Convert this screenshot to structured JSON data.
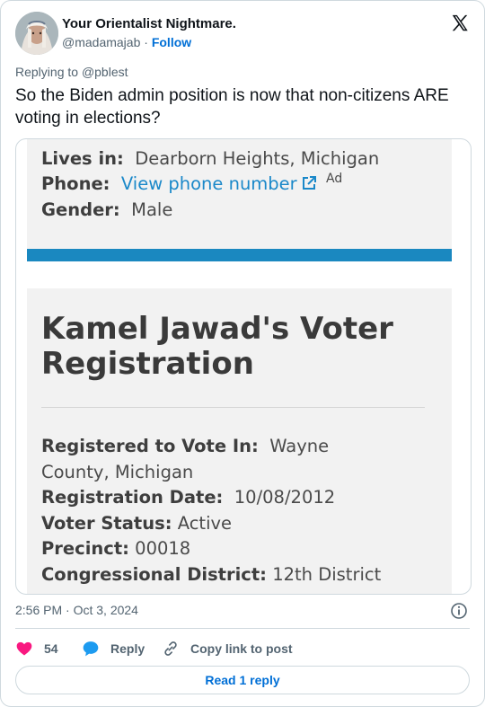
{
  "author": {
    "display_name": "Your Orientalist Nightmare.",
    "handle": "@madamajab",
    "separator": "·",
    "follow_label": "Follow"
  },
  "icons": {
    "brand": "x-logo-icon",
    "external_link": "external-link-icon",
    "info": "info-icon",
    "like": "heart-icon",
    "reply": "speech-bubble-icon",
    "copy": "link-icon"
  },
  "replying_to": {
    "prefix": "Replying to",
    "handle": "@pblest"
  },
  "tweet_text": "So the Biden admin position is now that non-citizens ARE voting in elections?",
  "media": {
    "lives_label": "Lives in:",
    "lives_value": "Dearborn Heights, Michigan",
    "phone_label": "Phone:",
    "phone_link": "View phone number",
    "ad_label": "Ad",
    "gender_label": "Gender:",
    "gender_value": "Male",
    "title": "Kamel Jawad's Voter Registration",
    "registered_label": "Registered to Vote In:",
    "registered_value_1": "Wayne",
    "registered_value_2": "County, Michigan",
    "reg_date_label": "Registration Date:",
    "reg_date_value": "10/08/2012",
    "status_label": "Voter Status:",
    "status_value": "Active",
    "precinct_label": "Precinct:",
    "precinct_value": "00018",
    "district_label": "Congressional District:",
    "district_value": "12th District",
    "colors": {
      "accent_bar": "#1a88c0",
      "link": "#1a88c9"
    }
  },
  "timestamp": "2:56 PM · Oct 3, 2024",
  "actions": {
    "like_count": "54",
    "reply_label": "Reply",
    "copy_label": "Copy link to post"
  },
  "read_replies_label": "Read 1 reply",
  "colors": {
    "like": "#f91880",
    "reply": "#1d9bf0",
    "follow": "#006fd6"
  }
}
